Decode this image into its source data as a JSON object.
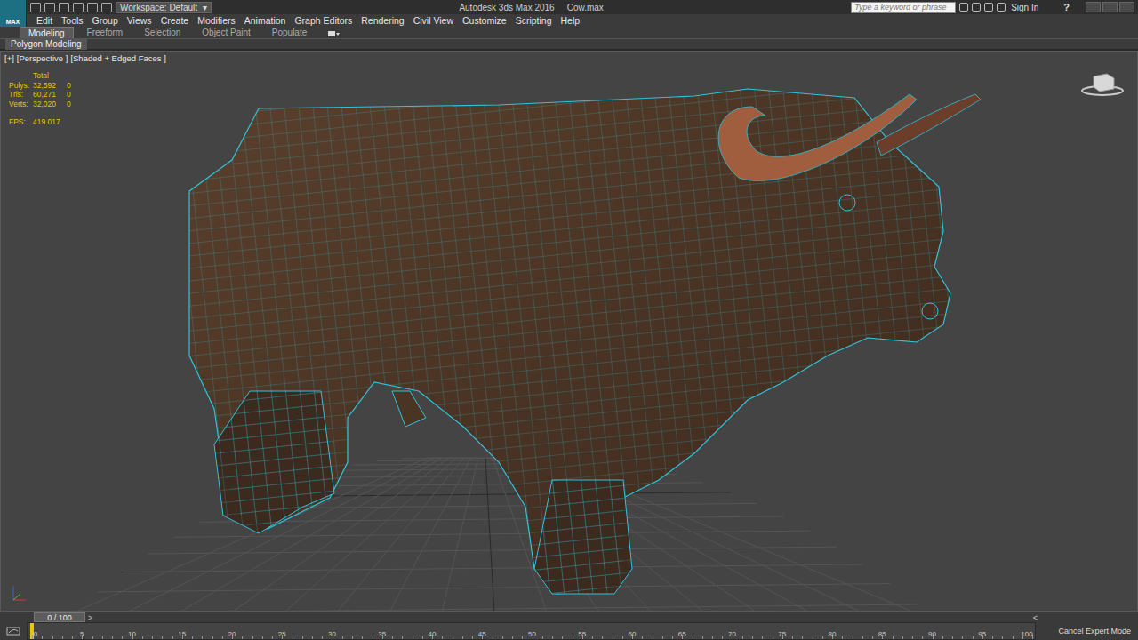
{
  "app_logo": "MAX",
  "title_bar": {
    "workspace": "Workspace: Default",
    "workspace_arrow": "▾",
    "title": "Autodesk 3ds Max 2016",
    "file": "Cow.max",
    "search_placeholder": "Type a keyword or phrase",
    "sign_in": "Sign In",
    "help": "?"
  },
  "menu": [
    "Edit",
    "Tools",
    "Group",
    "Views",
    "Create",
    "Modifiers",
    "Animation",
    "Graph Editors",
    "Rendering",
    "Civil View",
    "Customize",
    "Scripting",
    "Help"
  ],
  "ribbon_tabs": [
    {
      "label": "Modeling",
      "selected": true
    },
    {
      "label": "Freeform",
      "selected": false
    },
    {
      "label": "Selection",
      "selected": false
    },
    {
      "label": "Object Paint",
      "selected": false
    },
    {
      "label": "Populate",
      "selected": false
    }
  ],
  "ribbon_panel": "Polygon Modeling",
  "viewport": {
    "labels": [
      "[+]",
      "[Perspective ]",
      "[Shaded + Edged Faces ]"
    ],
    "stats": {
      "header": "Total",
      "rows": [
        {
          "label": "Polys:",
          "total": "32,592",
          "selected": "0"
        },
        {
          "label": "Tris:",
          "total": "60,271",
          "selected": "0"
        },
        {
          "label": "Verts:",
          "total": "32,020",
          "selected": "0"
        }
      ],
      "fps_label": "FPS:",
      "fps": "419.017"
    }
  },
  "timeline": {
    "position": "0 / 100",
    "prev": "<",
    "next": ">",
    "ticks": [
      "0",
      "5",
      "10",
      "15",
      "20",
      "25",
      "30",
      "35",
      "40",
      "45",
      "50",
      "55",
      "60",
      "65",
      "70",
      "75",
      "80",
      "85",
      "90",
      "95",
      "100"
    ]
  },
  "status": "Cancel Expert Mode"
}
